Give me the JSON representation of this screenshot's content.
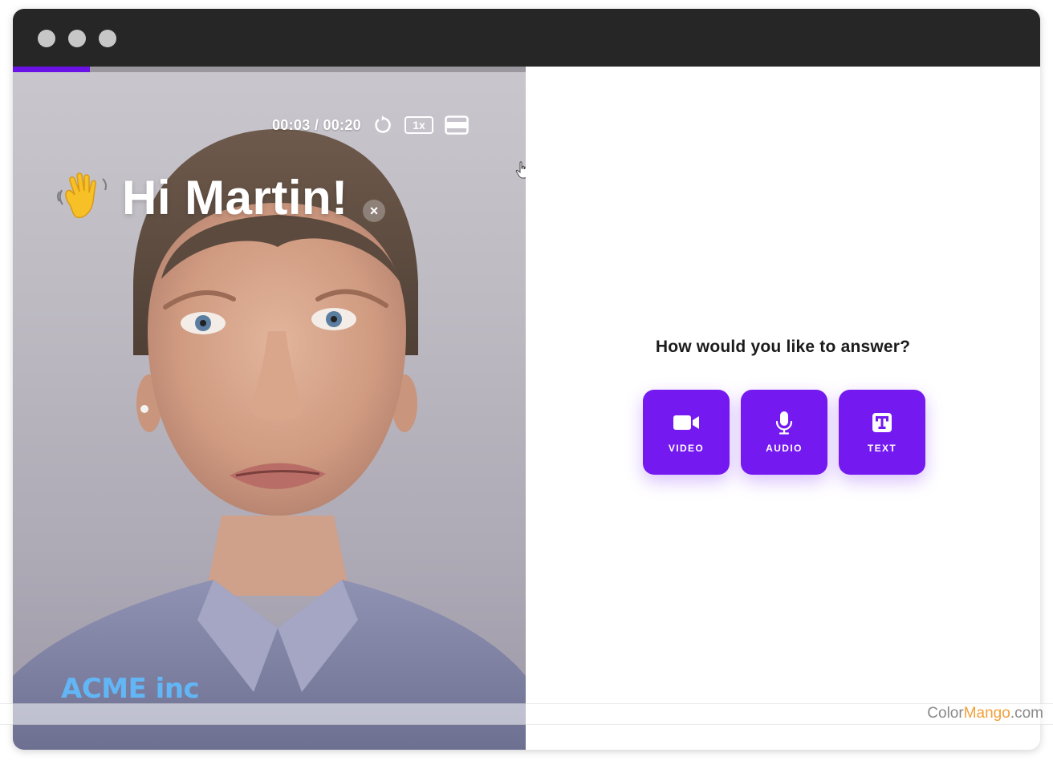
{
  "window": {
    "traffic_lights": [
      "close",
      "minimize",
      "maximize"
    ]
  },
  "video": {
    "progress": 0.15,
    "time": "00:03 / 00:20",
    "speed": "1x",
    "greeting": "Hi Martin!",
    "close_symbol": "×",
    "logo": "ACME inc",
    "icons": [
      "replay-icon",
      "layout-icon",
      "waving-hand-icon",
      "pointer-cursor-icon"
    ]
  },
  "answer": {
    "question": "How would you like to answer?",
    "options": [
      {
        "label": "VIDEO",
        "icon": "video-camera-icon"
      },
      {
        "label": "AUDIO",
        "icon": "microphone-icon"
      },
      {
        "label": "TEXT",
        "icon": "text-icon"
      }
    ]
  },
  "watermark": {
    "part1": "Color",
    "part2": "Mango",
    "part3": ".com"
  },
  "colors": {
    "accent": "#7419f0",
    "titlebar": "#262626",
    "logo": "#62b6f5"
  }
}
